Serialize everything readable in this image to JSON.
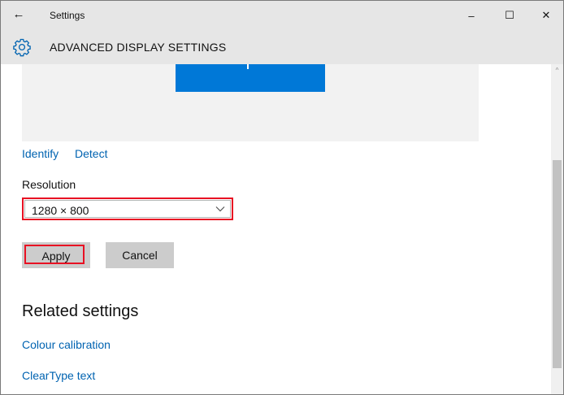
{
  "window": {
    "title": "Settings",
    "back_icon": "←",
    "minimize_icon": "–",
    "maximize_icon": "☐",
    "close_icon": "✕"
  },
  "header": {
    "title": "ADVANCED DISPLAY SETTINGS",
    "icon": "gear-icon"
  },
  "display": {
    "identify_label": "Identify",
    "detect_label": "Detect",
    "monitor_color": "#0078d7"
  },
  "resolution": {
    "label": "Resolution",
    "selected": "1280 × 800"
  },
  "buttons": {
    "apply_label": "Apply",
    "cancel_label": "Cancel"
  },
  "related": {
    "heading": "Related settings",
    "links": [
      "Colour calibration",
      "ClearType text"
    ]
  },
  "colors": {
    "accent": "#0078d7",
    "link": "#0063b1",
    "highlight": "#e81123",
    "titlebar": "#e6e6e6"
  }
}
